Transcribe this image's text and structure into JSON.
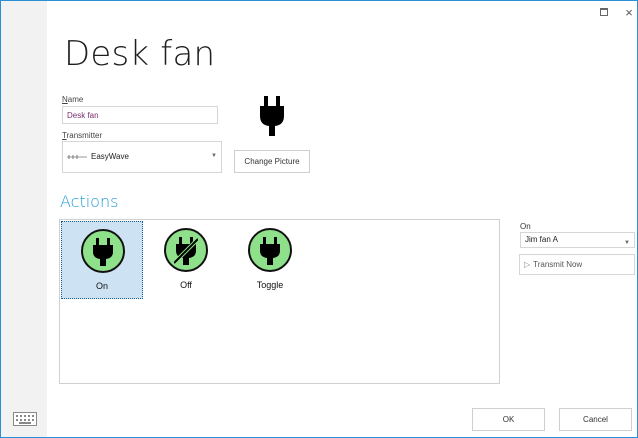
{
  "window": {
    "restore_icon": "restore-icon",
    "close_glyph": "×"
  },
  "header": {
    "title": "Desk fan"
  },
  "form": {
    "name_label_accel": "N",
    "name_label_rest": "ame",
    "name_value": "Desk fan",
    "transmitter_label_accel": "T",
    "transmitter_label_rest": "ransmitter",
    "transmitter_value": "EasyWave",
    "change_picture_label": "Change Picture"
  },
  "actions": {
    "heading": "Actions",
    "items": [
      {
        "label": "On",
        "icon": "plug-icon",
        "selected": true
      },
      {
        "label": "Off",
        "icon": "plug-off-icon",
        "selected": false
      },
      {
        "label": "Toggle",
        "icon": "plug-icon",
        "selected": false
      }
    ]
  },
  "side_panel": {
    "on_label": "On",
    "receiver_value": "Jim fan A",
    "transmit_label": "Transmit Now"
  },
  "footer": {
    "ok_label": "OK",
    "cancel_label": "Cancel"
  },
  "colors": {
    "accent": "#1e9ad6",
    "action_fill": "#8fe08a",
    "selection": "#cde3f3",
    "frame": "#2b8fd6"
  }
}
